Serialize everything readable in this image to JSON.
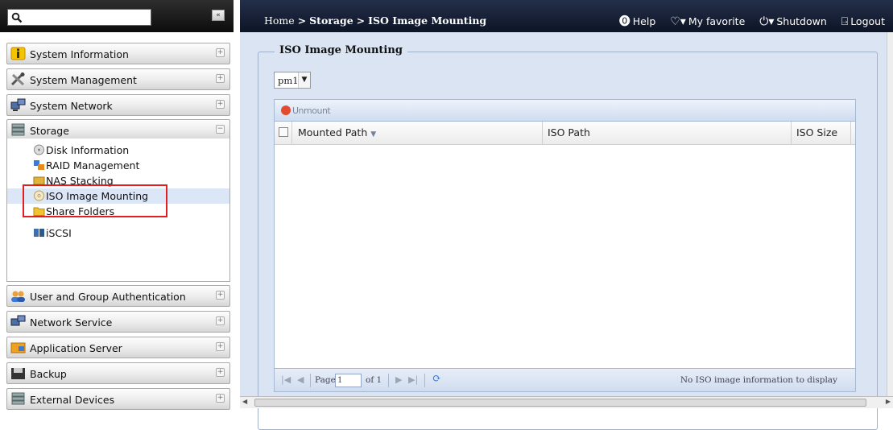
{
  "sidebar": {
    "search_value": "",
    "collapse_label": "«",
    "sections_top": [
      {
        "label": "System Information",
        "icon": "info-icon"
      },
      {
        "label": "System Management",
        "icon": "tools-icon"
      },
      {
        "label": "System Network",
        "icon": "network-icon"
      },
      {
        "label": "Storage",
        "icon": "storage-icon"
      }
    ],
    "storage_items": [
      {
        "label": "Disk Information",
        "icon": "disk-icon"
      },
      {
        "label": "RAID Management",
        "icon": "raid-icon"
      },
      {
        "label": "NAS Stacking",
        "icon": "nas-stacking-icon"
      },
      {
        "label": "ISO Image Mounting",
        "icon": "iso-icon",
        "selected": true
      },
      {
        "label": "Share Folders",
        "icon": "folder-icon"
      },
      {
        "label": "iSCSI",
        "icon": "iscsi-icon"
      }
    ],
    "sections_bottom": [
      {
        "label": "User and Group Authentication",
        "icon": "users-icon"
      },
      {
        "label": "Network Service",
        "icon": "network-service-icon"
      },
      {
        "label": "Application Server",
        "icon": "app-server-icon"
      },
      {
        "label": "Backup",
        "icon": "backup-icon"
      },
      {
        "label": "External Devices",
        "icon": "external-devices-icon"
      }
    ]
  },
  "topbar": {
    "breadcrumb_home": "Home",
    "breadcrumb_sep": ">",
    "breadcrumb_storage": "Storage",
    "breadcrumb_page": "ISO Image Mounting",
    "help": "Help",
    "favorite": "My favorite",
    "shutdown": "Shutdown",
    "logout": "Logout"
  },
  "panel": {
    "title": "ISO Image Mounting",
    "select_value": "pm1",
    "unmount_label": "Unmount",
    "columns": [
      "Mounted Path",
      "ISO Path",
      "ISO Size"
    ],
    "page_label": "Page",
    "page_value": "1",
    "of_label": "of 1",
    "status": "No ISO image information to display"
  }
}
